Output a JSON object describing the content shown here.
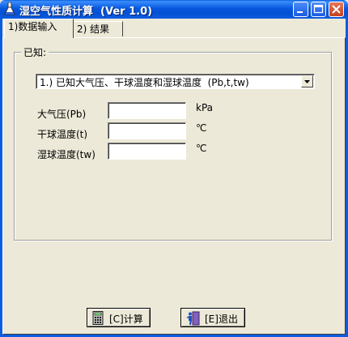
{
  "window": {
    "title": "湿空气性质计算  (Ver 1.0)"
  },
  "tabs": [
    {
      "label": "1)数据输入"
    },
    {
      "label": "2) 结果"
    }
  ],
  "known_group": {
    "legend": "已知:"
  },
  "mode_select": {
    "selected": "1.) 已知大气压、干球温度和湿球温度  (Pb,t,tw)"
  },
  "fields": [
    {
      "label": "大气压(Pb)",
      "value": "",
      "unit": "kPa"
    },
    {
      "label": "干球温度(t)",
      "value": "",
      "unit": "℃"
    },
    {
      "label": "湿球温度(tw)",
      "value": "",
      "unit": "℃"
    }
  ],
  "buttons": {
    "calculate": "[C]计算",
    "exit": "[E]退出"
  },
  "colors": {
    "titlebar": "#0A5CE0",
    "face": "#ECE9D8"
  }
}
